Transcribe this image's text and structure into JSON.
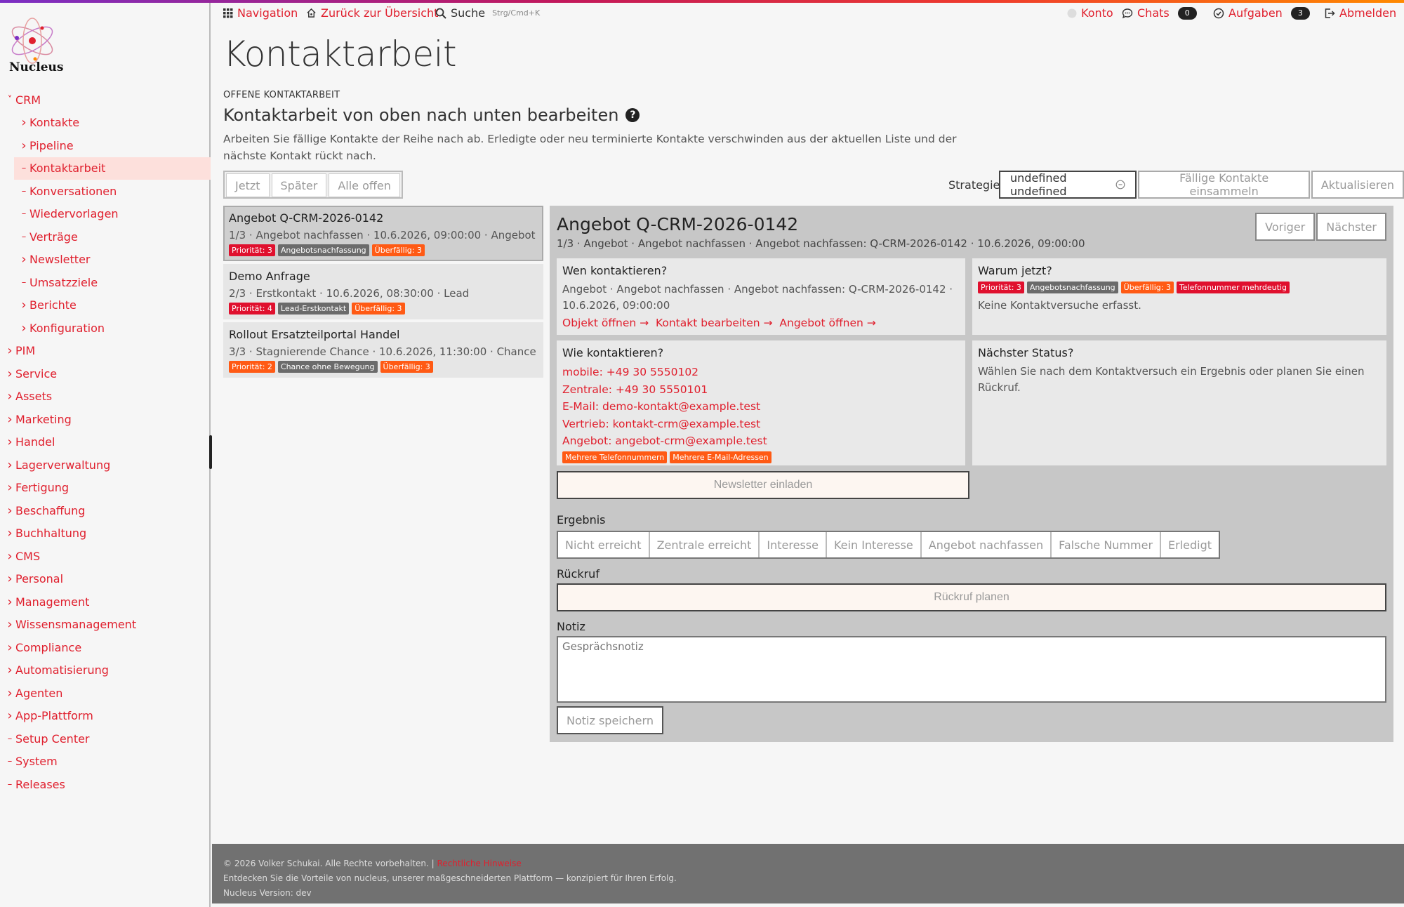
{
  "app": {
    "name": "Nucleus"
  },
  "colors": {
    "accent": "#e0202e",
    "priority_red": "#e0102e",
    "overdue_orange": "#ff5a14",
    "tag_gray": "#6b6b6b"
  },
  "sidebar": {
    "items": [
      {
        "label": "CRM",
        "level": 0,
        "state": "open"
      },
      {
        "label": "Kontakte",
        "level": 1,
        "state": "closed"
      },
      {
        "label": "Pipeline",
        "level": 1,
        "state": "closed"
      },
      {
        "label": "Kontaktarbeit",
        "level": 1,
        "state": "leaf",
        "active": true
      },
      {
        "label": "Konversationen",
        "level": 1,
        "state": "leaf"
      },
      {
        "label": "Wiedervorlagen",
        "level": 1,
        "state": "leaf"
      },
      {
        "label": "Verträge",
        "level": 1,
        "state": "leaf"
      },
      {
        "label": "Newsletter",
        "level": 1,
        "state": "closed"
      },
      {
        "label": "Umsatzziele",
        "level": 1,
        "state": "leaf"
      },
      {
        "label": "Berichte",
        "level": 1,
        "state": "closed"
      },
      {
        "label": "Konfiguration",
        "level": 1,
        "state": "closed"
      },
      {
        "label": "PIM",
        "level": 0,
        "state": "closed"
      },
      {
        "label": "Service",
        "level": 0,
        "state": "closed"
      },
      {
        "label": "Assets",
        "level": 0,
        "state": "closed"
      },
      {
        "label": "Marketing",
        "level": 0,
        "state": "closed"
      },
      {
        "label": "Handel",
        "level": 0,
        "state": "closed"
      },
      {
        "label": "Lagerverwaltung",
        "level": 0,
        "state": "closed"
      },
      {
        "label": "Fertigung",
        "level": 0,
        "state": "closed"
      },
      {
        "label": "Beschaffung",
        "level": 0,
        "state": "closed"
      },
      {
        "label": "Buchhaltung",
        "level": 0,
        "state": "closed"
      },
      {
        "label": "CMS",
        "level": 0,
        "state": "closed"
      },
      {
        "label": "Personal",
        "level": 0,
        "state": "closed"
      },
      {
        "label": "Management",
        "level": 0,
        "state": "closed"
      },
      {
        "label": "Wissensmanagement",
        "level": 0,
        "state": "closed"
      },
      {
        "label": "Compliance",
        "level": 0,
        "state": "closed"
      },
      {
        "label": "Automatisierung",
        "level": 0,
        "state": "closed"
      },
      {
        "label": "Agenten",
        "level": 0,
        "state": "closed"
      },
      {
        "label": "App-Plattform",
        "level": 0,
        "state": "closed"
      },
      {
        "label": "Setup Center",
        "level": 0,
        "state": "leaf"
      },
      {
        "label": "System",
        "level": 0,
        "state": "leaf"
      },
      {
        "label": "Releases",
        "level": 0,
        "state": "leaf"
      }
    ]
  },
  "header": {
    "navigation": "Navigation",
    "back": "Zurück zur Übersicht",
    "search": "Suche",
    "search_shortcut": "Strg/Cmd+K",
    "account": "Konto",
    "chats": "Chats",
    "chats_count": "0",
    "tasks": "Aufgaben",
    "tasks_count": "3",
    "logout": "Abmelden"
  },
  "page": {
    "title": "Kontaktarbeit",
    "eyebrow": "OFFENE KONTAKTARBEIT",
    "subtitle": "Kontaktarbeit von oben nach unten bearbeiten",
    "help": "?",
    "description": "Arbeiten Sie fällige Kontakte der Reihe nach ab. Erledigte oder neu terminierte Kontakte verschwinden aus der aktuellen Liste und der nächste Kontakt rückt nach."
  },
  "filters": {
    "now": "Jetzt",
    "later": "Später",
    "all": "Alle offen"
  },
  "strategy": {
    "label": "Strategie",
    "value": "undefined undefined",
    "collect": "Fällige Kontakte einsammeln",
    "refresh": "Aktualisieren"
  },
  "queue": [
    {
      "title": "Angebot Q-CRM-2026-0142",
      "meta": "1/3 · Angebot nachfassen · 10.6.2026, 09:00:00 · Angebot",
      "tags": [
        {
          "text": "Priorität: 3",
          "kind": "red"
        },
        {
          "text": "Angebotsnachfassung",
          "kind": "gray"
        },
        {
          "text": "Überfällig: 3",
          "kind": "orange"
        }
      ]
    },
    {
      "title": "Demo Anfrage",
      "meta": "2/3 · Erstkontakt · 10.6.2026, 08:30:00 · Lead",
      "tags": [
        {
          "text": "Priorität: 4",
          "kind": "red"
        },
        {
          "text": "Lead-Erstkontakt",
          "kind": "gray"
        },
        {
          "text": "Überfällig: 3",
          "kind": "orange"
        }
      ]
    },
    {
      "title": "Rollout Ersatzteilportal Handel",
      "meta": "3/3 · Stagnierende Chance · 10.6.2026, 11:30:00 · Chance",
      "tags": [
        {
          "text": "Priorität: 2",
          "kind": "orange"
        },
        {
          "text": "Chance ohne Bewegung",
          "kind": "gray"
        },
        {
          "text": "Überfällig: 3",
          "kind": "orange"
        }
      ]
    }
  ],
  "detail": {
    "title": "Angebot Q-CRM-2026-0142",
    "meta": "1/3 · Angebot · Angebot nachfassen · Angebot nachfassen: Q-CRM-2026-0142 · 10.6.2026, 09:00:00",
    "prev": "Voriger",
    "next": "Nächster",
    "who": {
      "heading": "Wen kontaktieren?",
      "text": "Angebot · Angebot nachfassen · Angebot nachfassen: Q-CRM-2026-0142 · 10.6.2026, 09:00:00",
      "link_object": "Objekt öffnen →",
      "link_contact": "Kontakt bearbeiten →",
      "link_offer": "Angebot öffnen →"
    },
    "why": {
      "heading": "Warum jetzt?",
      "tags": [
        {
          "text": "Priorität: 3",
          "kind": "red"
        },
        {
          "text": "Angebotsnachfassung",
          "kind": "gray"
        },
        {
          "text": "Überfällig: 3",
          "kind": "orange"
        },
        {
          "text": "Telefonnummer mehrdeutig",
          "kind": "red"
        }
      ],
      "text": "Keine Kontaktversuche erfasst."
    },
    "how": {
      "heading": "Wie kontaktieren?",
      "channels": [
        "mobile: +49 30 5550102",
        "Zentrale: +49 30 5550101",
        "E-Mail: demo-kontakt@example.test",
        "Vertrieb: kontakt-crm@example.test",
        "Angebot: angebot-crm@example.test"
      ],
      "tags": [
        {
          "text": "Mehrere Telefonnummern",
          "kind": "orange"
        },
        {
          "text": "Mehrere E-Mail-Adressen",
          "kind": "orange"
        }
      ]
    },
    "next_status": {
      "heading": "Nächster Status?",
      "text": "Wählen Sie nach dem Kontaktversuch ein Ergebnis oder planen Sie einen Rückruf."
    },
    "newsletter": "Newsletter einladen",
    "result_label": "Ergebnis",
    "results": [
      "Nicht erreicht",
      "Zentrale erreicht",
      "Interesse",
      "Kein Interesse",
      "Angebot nachfassen",
      "Falsche Nummer",
      "Erledigt"
    ],
    "callback_label": "Rückruf",
    "callback_button": "Rückruf planen",
    "note_label": "Notiz",
    "note_placeholder": "Gesprächsnotiz",
    "note_save": "Notiz speichern"
  },
  "footer": {
    "copyright": "© 2026 Volker Schukai. Alle Rechte vorbehalten. |",
    "legal": "Rechtliche Hinweise",
    "tagline": "Entdecken Sie die Vorteile von nucleus, unserer maßgeschneiderten Plattform — konzipiert für Ihren Erfolg.",
    "version": "Nucleus Version: dev"
  }
}
